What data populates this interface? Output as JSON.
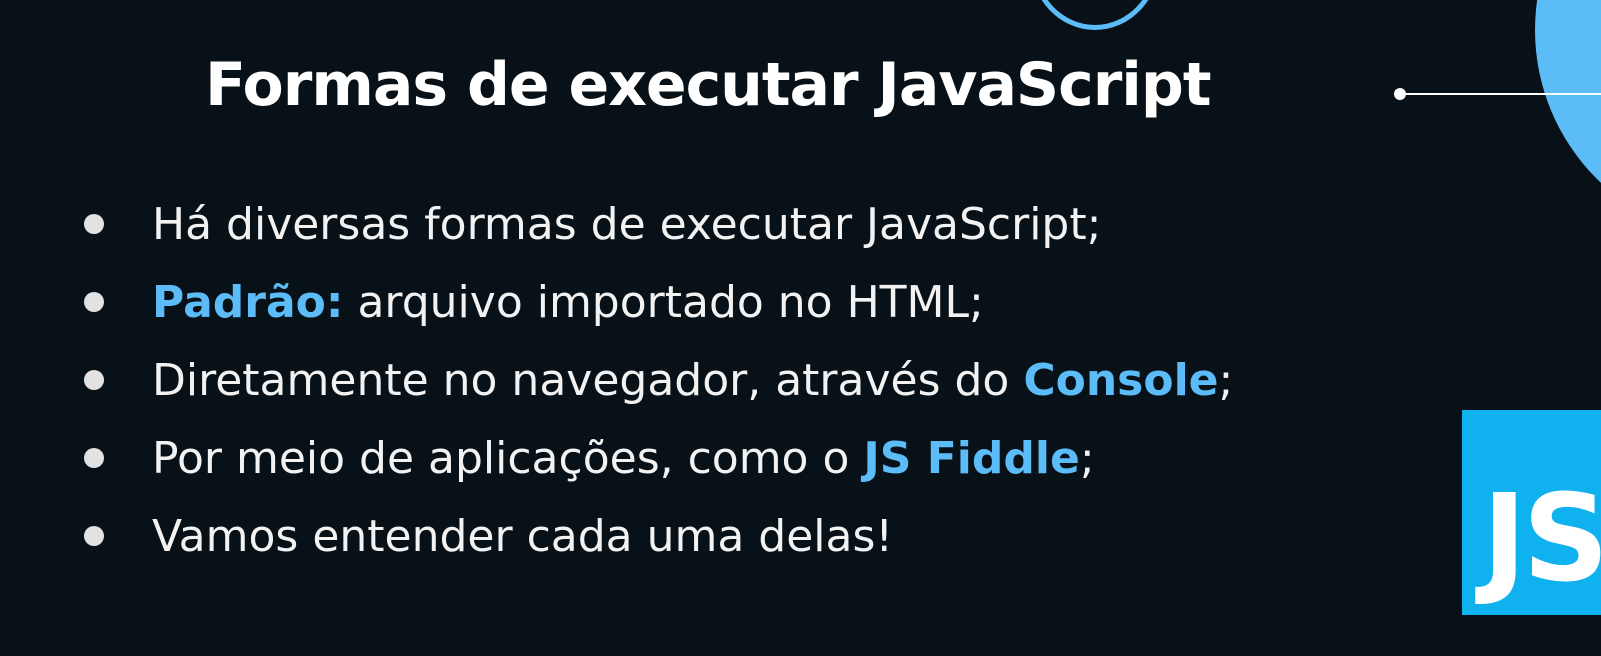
{
  "slide": {
    "title": "Formas de executar JavaScript",
    "bullets": [
      {
        "pre": "Há diversas formas de executar JavaScript;",
        "highlight": "",
        "post": ""
      },
      {
        "pre": "",
        "highlight": "Padrão:",
        "post": " arquivo importado no HTML;"
      },
      {
        "pre": "Diretamente no navegador, através do ",
        "highlight": "Console",
        "post": ";"
      },
      {
        "pre": "Por meio de aplicações, como o ",
        "highlight": "JS Fiddle",
        "post": ";"
      },
      {
        "pre": "Vamos entender cada uma delas!",
        "highlight": "",
        "post": ""
      }
    ],
    "logo_text": "JS"
  },
  "colors": {
    "background": "#071117",
    "accent": "#5bbcf7",
    "logo": "#10b1ef"
  }
}
